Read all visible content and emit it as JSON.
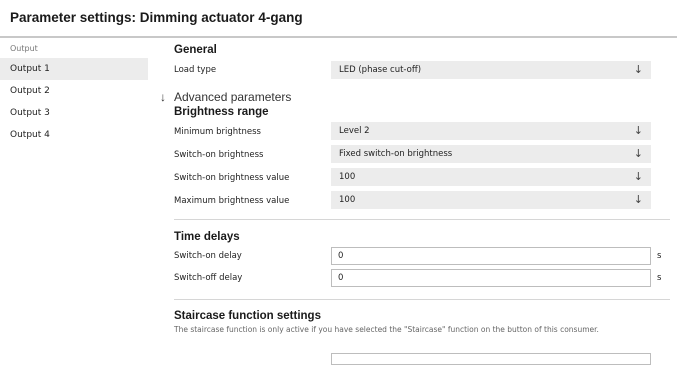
{
  "header": {
    "title": "Parameter settings: Dimming actuator 4-gang"
  },
  "sidebar": {
    "heading": "Output",
    "items": [
      {
        "label": "Output 1",
        "active": true
      },
      {
        "label": "Output 2",
        "active": false
      },
      {
        "label": "Output 3",
        "active": false
      },
      {
        "label": "Output 4",
        "active": false
      }
    ]
  },
  "general": {
    "title": "General",
    "load_type": {
      "label": "Load type",
      "value": "LED (phase cut-off)"
    }
  },
  "advanced": {
    "label": "Advanced parameters",
    "icon": "arrow-down-icon"
  },
  "brightness": {
    "title": "Brightness range",
    "rows": [
      {
        "label": "Minimum brightness",
        "value": "Level 2"
      },
      {
        "label": "Switch-on brightness",
        "value": "Fixed switch-on brightness"
      },
      {
        "label": "Switch-on brightness value",
        "value": "100"
      },
      {
        "label": "Maximum brightness value",
        "value": "100"
      }
    ]
  },
  "time_delays": {
    "title": "Time delays",
    "switch_on": {
      "label": "Switch-on delay",
      "value": "0",
      "unit": "s"
    },
    "switch_off": {
      "label": "Switch-off delay",
      "value": "0",
      "unit": "s"
    }
  },
  "staircase": {
    "title": "Staircase function settings",
    "note": "The staircase function is only active if you have selected the \"Staircase\" function on the button of this consumer."
  },
  "icons": {
    "dropdown": "chevron-down-icon",
    "chevron_glyph": "↓"
  }
}
